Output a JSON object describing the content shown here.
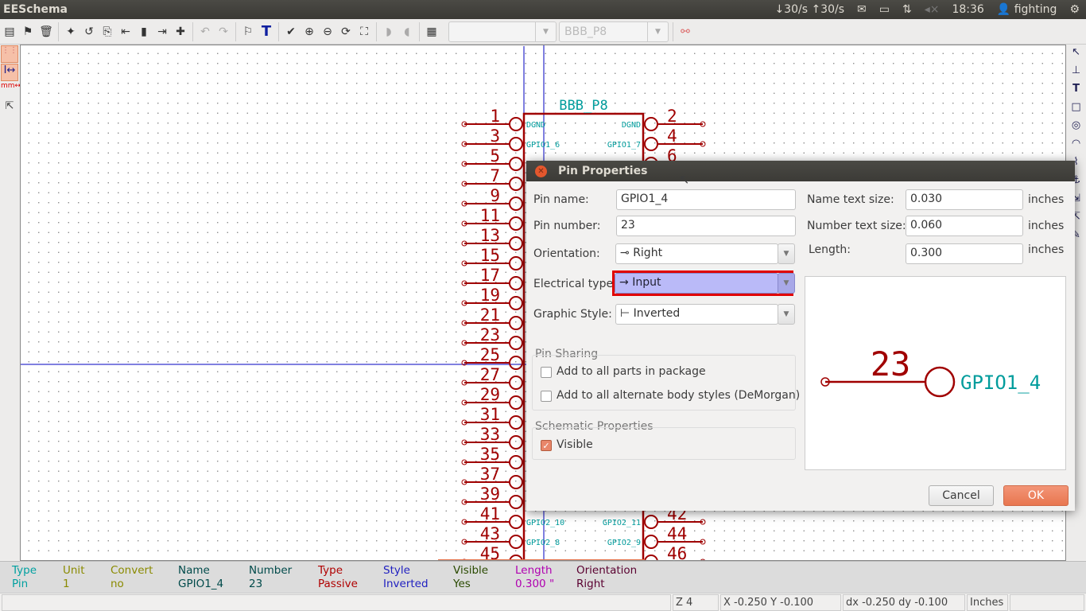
{
  "app": {
    "title": "EESchema"
  },
  "tray": {
    "net": "↓30/s ↑30/s",
    "time": "18:36",
    "user": "fighting"
  },
  "toolbar": {
    "icons": [
      "new-sheet-icon",
      "open-icon",
      "trash-icon",
      "new-lib-icon",
      "undo-part-icon",
      "load-part-icon",
      "import-icon",
      "save-part-icon",
      "export-icon",
      "new-component-icon",
      "undo-icon",
      "redo-icon",
      "edit-properties-icon",
      "text-icon",
      "check-icon",
      "zoom-in-icon",
      "zoom-out-icon",
      "zoom-redraw-icon",
      "zoom-fit-icon",
      "demorgan-normal-icon",
      "demorgan-convert-icon",
      "pdf-icon"
    ],
    "unit_combo": "",
    "alias_combo": "BBB_P8"
  },
  "component": {
    "name": "BBB_P8",
    "left_pins": [
      {
        "num": "1",
        "name": "DGND"
      },
      {
        "num": "3",
        "name": "GPIO1_6"
      },
      {
        "num": "5"
      },
      {
        "num": "7"
      },
      {
        "num": "9"
      },
      {
        "num": "11"
      },
      {
        "num": "13"
      },
      {
        "num": "15"
      },
      {
        "num": "17"
      },
      {
        "num": "19"
      },
      {
        "num": "21"
      },
      {
        "num": "23"
      },
      {
        "num": "25"
      },
      {
        "num": "27"
      },
      {
        "num": "29"
      },
      {
        "num": "31"
      },
      {
        "num": "33"
      },
      {
        "num": "35"
      },
      {
        "num": "37"
      },
      {
        "num": "39"
      },
      {
        "num": "41",
        "name": "GPIO2_10"
      },
      {
        "num": "43",
        "name": "GPIO2_8"
      },
      {
        "num": "45"
      }
    ],
    "right_pins": [
      {
        "num": "2",
        "name": "DGND"
      },
      {
        "num": "4",
        "name": "GPIO1_7"
      },
      {
        "num": "6"
      },
      {
        "num": "42",
        "name": "GPIO2_11",
        "row": 20
      },
      {
        "num": "44",
        "name": "GPIO2_9",
        "row": 21
      },
      {
        "num": "46",
        "row": 22
      }
    ],
    "colors": {
      "pin": "#a00000",
      "text": "#009c9c",
      "cursor": "#0000c0"
    }
  },
  "dialog": {
    "title": "Pin Properties",
    "pin_name_label": "Pin name:",
    "pin_name": "GPIO1_4",
    "pin_number_label": "Pin number:",
    "pin_number": "23",
    "orientation_label": "Orientation:",
    "orientation": "Right",
    "orientation_icon": "⊸",
    "electrical_label": "Electrical type:",
    "electrical": "Input",
    "graphic_label": "Graphic Style:",
    "graphic": "Inverted",
    "name_size_label": "Name text size:",
    "name_size": "0.030",
    "number_size_label": "Number text size:",
    "number_size": "0.060",
    "length_label": "Length:",
    "length": "0.300",
    "unit": "inches",
    "sharing_title": "Pin Sharing",
    "share_parts": "Add to all parts in package",
    "share_styles": "Add to all alternate body styles (DeMorgan)",
    "schematic_title": "Schematic Properties",
    "visible": "Visible",
    "visible_checked": true,
    "cancel": "Cancel",
    "ok": "OK",
    "preview": {
      "number": "23",
      "name": "GPIO1_4"
    }
  },
  "msgpanel": [
    {
      "h": "Type",
      "v": "Pin",
      "c": "#00a0a0"
    },
    {
      "h": "Unit",
      "v": "1",
      "c": "#8a8a00"
    },
    {
      "h": "Convert",
      "v": "no",
      "c": "#8a8a00"
    },
    {
      "h": "Name",
      "v": "GPIO1_4",
      "c": "#004a4a"
    },
    {
      "h": "Number",
      "v": "23",
      "c": "#004a4a"
    },
    {
      "h": "Type",
      "v": "Passive",
      "c": "#b00000"
    },
    {
      "h": "Style",
      "v": "Inverted",
      "c": "#2020c0"
    },
    {
      "h": "Visible",
      "v": "Yes",
      "c": "#2a4a00"
    },
    {
      "h": "Length",
      "v": "0.300 \"",
      "c": "#b000b0"
    },
    {
      "h": "Orientation",
      "v": "Right",
      "c": "#5a0030"
    }
  ],
  "status": {
    "zoom": "Z 4",
    "xy": "X -0.250  Y -0.100",
    "dxy": "dx -0.250  dy -0.100",
    "units": "Inches"
  }
}
